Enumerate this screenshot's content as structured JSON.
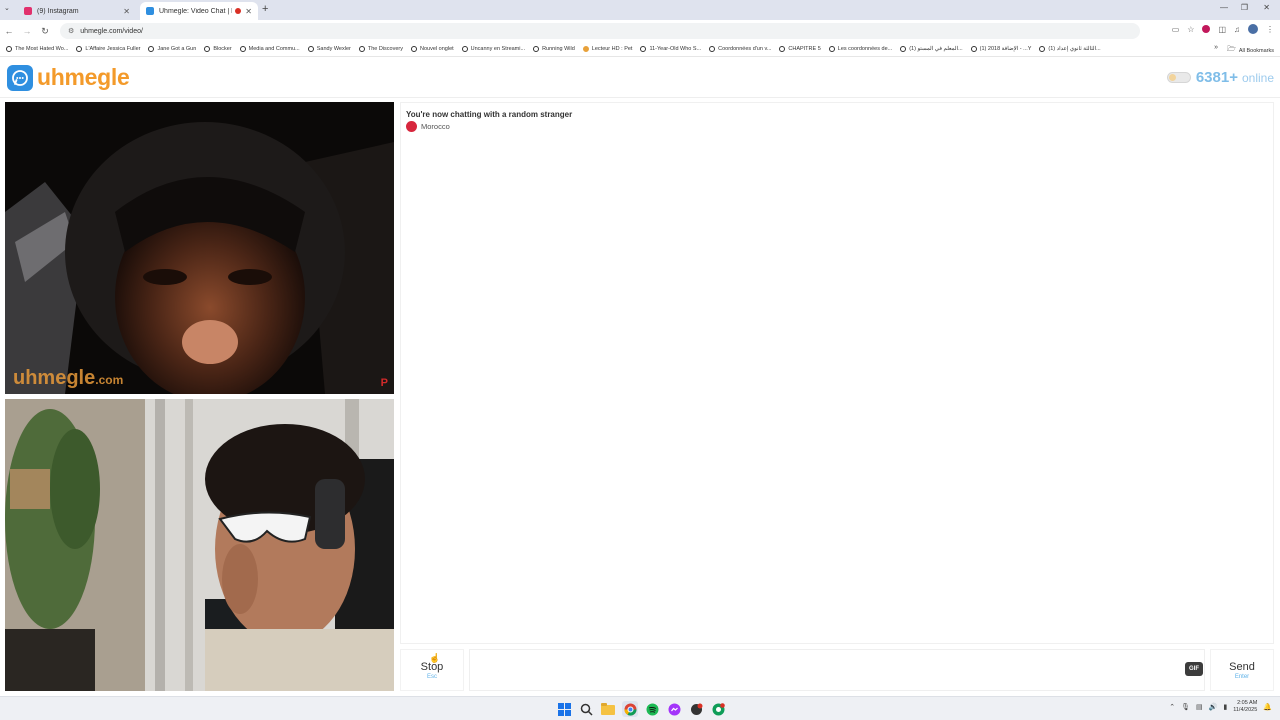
{
  "browser": {
    "tabs": [
      {
        "title": "(9) Instagram",
        "favicon_color": "#e1306c"
      },
      {
        "title": "Uhmegle: Video Chat | Ran",
        "favicon_color": "#2f8fe0"
      }
    ],
    "url": "uhmegle.com/video/",
    "bookmarks": [
      "The Most Hated Wo...",
      "L'Affaire Jessica Fuller",
      "Jane Got a Gun",
      "Blocker",
      "Media and Commu...",
      "Sandy Wexler",
      "The Discovery",
      "Nouvel onglet",
      "Uncanny en Streami...",
      "Running Wild",
      "Lecteur HD : Pet",
      "11-Year-Old Who S...",
      "Coordonnées d'un v...",
      "CHAPITRE 5",
      "Les coordonnées de...",
      "(1) المعلم في المستو...",
      "(1) الإضافة 2018 - ...Y",
      "(1) الثالثة ثانوي إعداد..."
    ],
    "all_bookmarks_label": "All Bookmarks"
  },
  "site": {
    "logo_text": "uhmegle",
    "online_count": "6381+",
    "online_label": "online"
  },
  "video": {
    "watermark": "uhmegle",
    "watermark_suffix": ".com",
    "corner_mark": "P"
  },
  "chat": {
    "status": "You're now chatting with a random stranger",
    "country": "Morocco",
    "country_color": "#d7263d"
  },
  "controls": {
    "stop_label": "Stop",
    "stop_hint": "Esc",
    "send_label": "Send",
    "send_hint": "Enter",
    "gif_label": "GIF",
    "message_placeholder": ""
  },
  "taskbar": {
    "time": "2:05 AM",
    "date": "11/4/2025"
  },
  "colors": {
    "brand_blue": "#2f8fe0",
    "brand_orange": "#f39a2a",
    "online_blue": "#7fbde8",
    "hint_blue": "#5fb2e8"
  }
}
